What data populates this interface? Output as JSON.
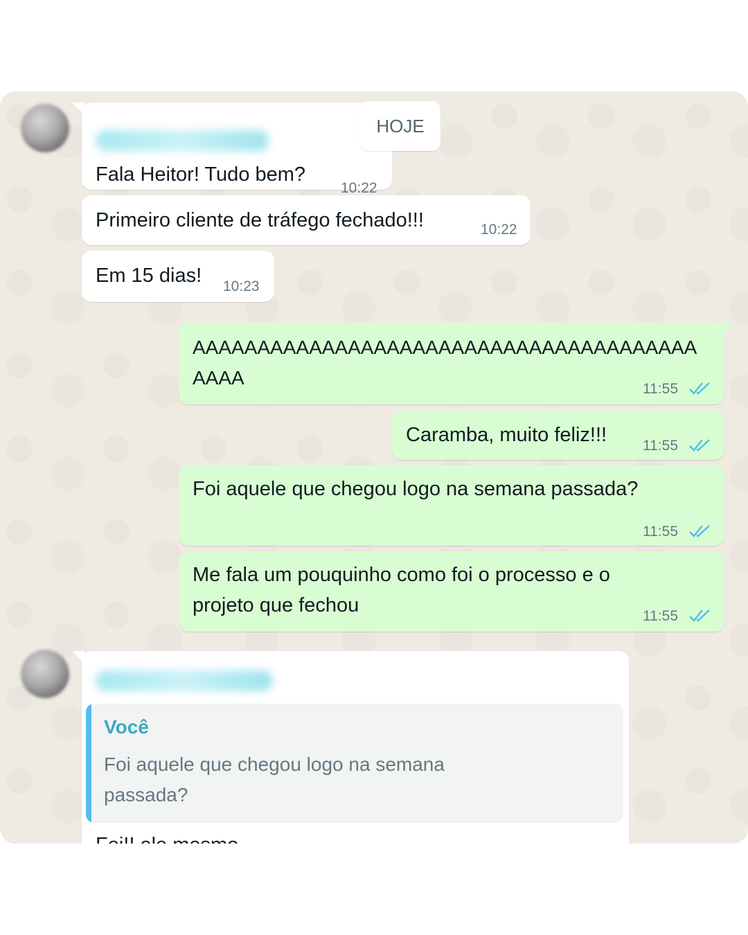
{
  "date_badge": "HOJE",
  "incoming": [
    {
      "text": "Fala Heitor! Tudo bem?",
      "time": "10:22"
    },
    {
      "text": "Primeiro cliente de tráfego fechado!!!",
      "time": "10:22"
    },
    {
      "text": "Em 15 dias!",
      "time": "10:23"
    }
  ],
  "outgoing": [
    {
      "text": "AAAAAAAAAAAAAAAAAAAAAAAAAAAAAAAAAAAAAAAAAAA",
      "time": "11:55"
    },
    {
      "text": "Caramba, muito feliz!!!",
      "time": "11:55"
    },
    {
      "text": "Foi aquele que chegou logo na semana passada?",
      "time": "11:55"
    },
    {
      "text": "Me fala um pouquinho como foi o processo e o projeto que fechou",
      "time": "11:55"
    }
  ],
  "reply": {
    "quoted_author": "Você",
    "quoted_text": "Foi aquele que chegou logo na semana passada?",
    "partial_text": "Foi!! ele mesmo"
  },
  "colors": {
    "chat_bg": "#efeae2",
    "incoming_bubble": "#ffffff",
    "outgoing_bubble": "#d9fdd3",
    "read_ticks": "#53bdeb",
    "quote_bar": "#53bdeb"
  },
  "icons": {
    "read_receipt": "double-check-icon",
    "avatar": "blurred-avatar"
  }
}
